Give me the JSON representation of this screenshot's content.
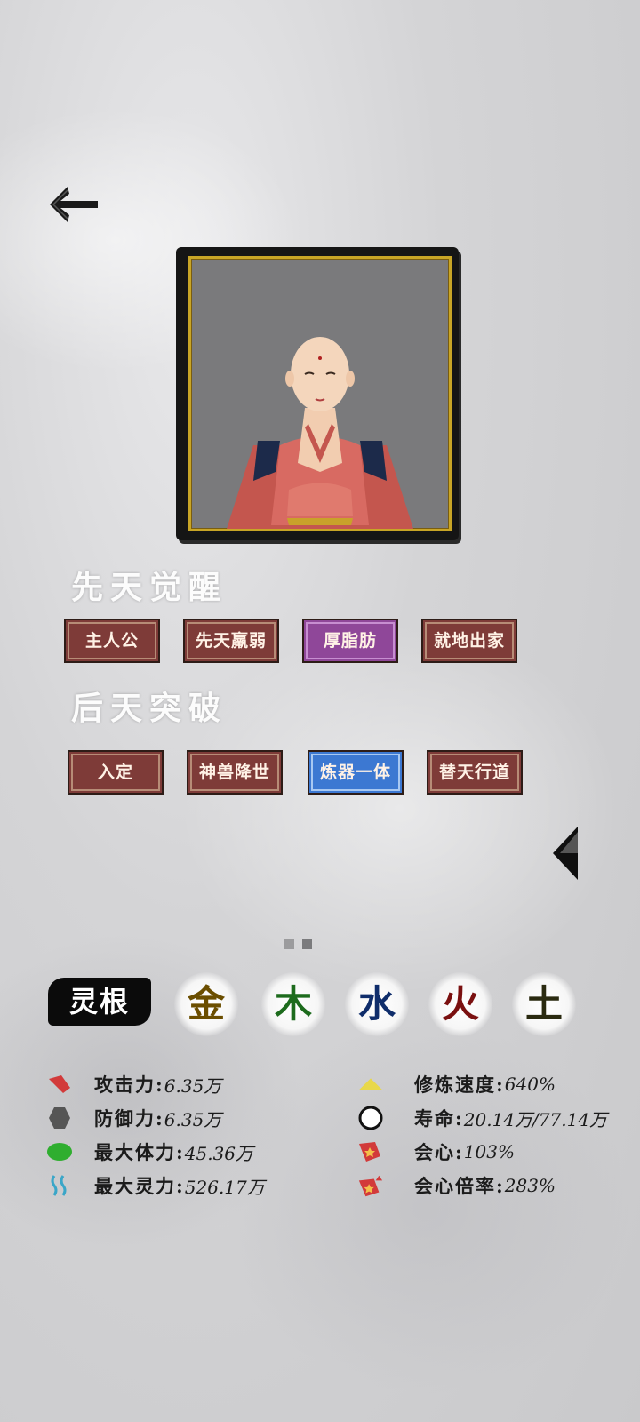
{
  "header": {
    "back_icon": "back-arrow-icon"
  },
  "portrait": {
    "frame_color": "#c8a526",
    "background": "#7a7a7c"
  },
  "innate": {
    "title": "先天觉醒",
    "tags": [
      {
        "label": "主人公",
        "color": "red"
      },
      {
        "label": "先天羸弱",
        "color": "red"
      },
      {
        "label": "厚脂肪",
        "color": "purple"
      },
      {
        "label": "就地出家",
        "color": "red"
      }
    ]
  },
  "acquired": {
    "title": "后天突破",
    "tags": [
      {
        "label": "入定",
        "color": "red"
      },
      {
        "label": "神兽降世",
        "color": "red"
      },
      {
        "label": "炼器一体",
        "color": "blue"
      },
      {
        "label": "替天行道",
        "color": "red"
      }
    ]
  },
  "pager": {
    "next_icon": "triangle-left-icon",
    "page_count": 2,
    "current_page": 2
  },
  "spirit_root": {
    "label": "灵根",
    "elements": [
      {
        "label": "金",
        "color": "#6b4e00"
      },
      {
        "label": "木",
        "color": "#1d6b1d"
      },
      {
        "label": "水",
        "color": "#0f2d6b"
      },
      {
        "label": "火",
        "color": "#7a1010"
      },
      {
        "label": "土",
        "color": "#2a2a10"
      }
    ]
  },
  "stats": {
    "left": [
      {
        "label": "攻击力:",
        "value": "6.35万",
        "icon": "attack-icon"
      },
      {
        "label": "防御力:",
        "value": "6.35万",
        "icon": "defense-icon"
      },
      {
        "label": "最大体力:",
        "value": "45.36万",
        "icon": "health-icon"
      },
      {
        "label": "最大灵力:",
        "value": "526.17万",
        "icon": "spirit-energy-icon"
      }
    ],
    "right": [
      {
        "label": "修炼速度:",
        "value": "640%",
        "icon": "cultivation-speed-icon"
      },
      {
        "label": "寿命:",
        "value": "20.14万/77.14万",
        "icon": "lifespan-icon"
      },
      {
        "label": "会心:",
        "value": "103%",
        "icon": "critical-icon"
      },
      {
        "label": "会心倍率:",
        "value": "283%",
        "icon": "critical-multiplier-icon"
      }
    ]
  }
}
